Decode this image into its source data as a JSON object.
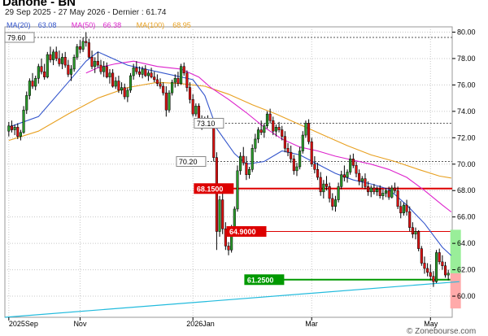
{
  "header": {
    "title": "Danone - BN",
    "subtitle": "29 Sep 2025 - 27 May 2026 - Dernier : 61.74"
  },
  "legend": [
    {
      "name": "MA(20)",
      "value": "63.08",
      "color": "#3355cc"
    },
    {
      "name": "MA(50)",
      "value": "66.38",
      "color": "#dd22cc"
    },
    {
      "name": "MA(100)",
      "value": "68.95",
      "color": "#e8a020"
    }
  ],
  "watermark": "© Zonebourse.com",
  "chart_data": {
    "type": "candlestick",
    "title": "Danone - BN",
    "y_axis": {
      "min": 58.4,
      "max": 80.4,
      "ticks": [
        "60.00",
        "62.00",
        "64.00",
        "66.00",
        "68.00",
        "70.00",
        "72.00",
        "74.00",
        "76.00",
        "78.00",
        "80.00"
      ],
      "position": "right"
    },
    "x_axis": {
      "labels": [
        "2025Sep",
        "Nov",
        "2026Jan",
        "Mar",
        "May"
      ],
      "label_index": [
        0,
        24,
        62,
        102,
        142
      ]
    },
    "ohlc": [
      [
        72.5,
        73.2,
        72.1,
        72.9
      ],
      [
        72.9,
        73.3,
        72.4,
        72.6
      ],
      [
        72.6,
        73.0,
        72.2,
        72.8
      ],
      [
        72.8,
        73.1,
        71.9,
        72.1
      ],
      [
        72.1,
        72.6,
        71.8,
        72.4
      ],
      [
        72.4,
        74.4,
        72.3,
        74.1
      ],
      [
        74.1,
        75.5,
        73.8,
        75.2
      ],
      [
        75.2,
        76.5,
        74.9,
        76.3
      ],
      [
        76.3,
        76.9,
        75.7,
        75.9
      ],
      [
        75.9,
        76.7,
        75.6,
        76.5
      ],
      [
        76.5,
        77.6,
        76.1,
        77.4
      ],
      [
        77.4,
        78.0,
        76.8,
        77.0
      ],
      [
        77.0,
        77.6,
        76.4,
        76.6
      ],
      [
        76.6,
        78.5,
        76.5,
        78.3
      ],
      [
        78.3,
        78.9,
        77.7,
        77.9
      ],
      [
        77.9,
        78.7,
        77.5,
        78.5
      ],
      [
        78.5,
        78.9,
        77.8,
        78.0
      ],
      [
        78.0,
        78.6,
        77.4,
        77.6
      ],
      [
        77.6,
        78.4,
        77.2,
        78.1
      ],
      [
        78.1,
        78.5,
        77.3,
        77.5
      ],
      [
        77.5,
        77.9,
        76.6,
        76.8
      ],
      [
        76.8,
        77.5,
        76.3,
        77.2
      ],
      [
        77.2,
        78.3,
        77.0,
        78.1
      ],
      [
        78.1,
        79.1,
        77.9,
        78.9
      ],
      [
        78.9,
        79.4,
        78.4,
        78.7
      ],
      [
        78.7,
        79.6,
        78.5,
        79.3
      ],
      [
        79.3,
        80.0,
        78.9,
        79.2
      ],
      [
        79.2,
        79.5,
        78.0,
        78.1
      ],
      [
        78.1,
        78.6,
        77.2,
        77.4
      ],
      [
        77.4,
        78.1,
        76.9,
        77.8
      ],
      [
        77.8,
        78.5,
        77.3,
        77.5
      ],
      [
        77.5,
        77.9,
        76.8,
        77.0
      ],
      [
        77.0,
        77.8,
        76.6,
        77.4
      ],
      [
        77.4,
        77.7,
        76.5,
        76.6
      ],
      [
        76.6,
        77.2,
        76.1,
        76.9
      ],
      [
        76.9,
        77.2,
        75.8,
        75.9
      ],
      [
        75.9,
        76.6,
        75.7,
        76.3
      ],
      [
        76.3,
        76.7,
        75.4,
        75.6
      ],
      [
        75.6,
        76.2,
        75.3,
        75.8
      ],
      [
        75.8,
        76.1,
        74.9,
        75.1
      ],
      [
        75.1,
        75.8,
        74.7,
        75.6
      ],
      [
        75.6,
        76.9,
        75.4,
        76.7
      ],
      [
        76.7,
        77.6,
        76.4,
        77.3
      ],
      [
        77.3,
        77.8,
        76.8,
        77.0
      ],
      [
        77.0,
        77.4,
        76.6,
        76.8
      ],
      [
        76.8,
        77.4,
        76.5,
        77.2
      ],
      [
        77.2,
        77.5,
        76.6,
        76.7
      ],
      [
        76.7,
        77.1,
        76.3,
        76.9
      ],
      [
        76.9,
        77.3,
        76.5,
        76.6
      ],
      [
        76.6,
        77.0,
        76.2,
        76.4
      ],
      [
        76.4,
        76.8,
        75.9,
        76.1
      ],
      [
        76.1,
        76.5,
        75.7,
        75.9
      ],
      [
        75.9,
        76.2,
        75.2,
        75.4
      ],
      [
        75.4,
        75.9,
        73.6,
        74.1
      ],
      [
        74.1,
        75.6,
        73.9,
        75.4
      ],
      [
        75.4,
        76.4,
        75.2,
        76.2
      ],
      [
        76.2,
        76.8,
        75.8,
        76.5
      ],
      [
        76.5,
        77.0,
        75.9,
        76.1
      ],
      [
        76.1,
        77.6,
        76.0,
        77.4
      ],
      [
        77.4,
        77.7,
        76.7,
        76.9
      ],
      [
        76.9,
        77.1,
        75.5,
        75.8
      ],
      [
        75.8,
        76.2,
        74.6,
        74.9
      ],
      [
        74.9,
        75.3,
        73.6,
        73.8
      ],
      [
        73.8,
        74.6,
        73.6,
        74.4
      ],
      [
        74.4,
        74.6,
        73.1,
        73.3
      ],
      [
        73.3,
        73.7,
        72.6,
        73.1
      ],
      [
        73.1,
        73.6,
        72.8,
        73.4
      ],
      [
        73.4,
        73.7,
        72.9,
        73.0
      ],
      [
        73.0,
        73.3,
        72.7,
        72.9
      ],
      [
        72.9,
        73.1,
        70.2,
        70.5
      ],
      [
        70.5,
        70.9,
        63.5,
        64.9
      ],
      [
        64.9,
        67.6,
        64.5,
        67.3
      ],
      [
        67.3,
        67.8,
        64.7,
        65.1
      ],
      [
        65.1,
        65.6,
        63.5,
        63.8
      ],
      [
        63.8,
        64.1,
        63.1,
        63.5
      ],
      [
        63.5,
        65.4,
        63.3,
        65.1
      ],
      [
        65.1,
        66.8,
        64.9,
        66.6
      ],
      [
        66.6,
        69.9,
        66.4,
        69.5
      ],
      [
        69.5,
        70.9,
        69.2,
        70.6
      ],
      [
        70.6,
        71.3,
        69.9,
        70.1
      ],
      [
        70.1,
        70.6,
        68.8,
        69.2
      ],
      [
        69.2,
        69.8,
        68.9,
        69.6
      ],
      [
        69.6,
        71.5,
        69.4,
        71.2
      ],
      [
        71.2,
        72.3,
        70.9,
        71.9
      ],
      [
        71.9,
        72.8,
        71.6,
        72.6
      ],
      [
        72.6,
        73.3,
        72.2,
        72.4
      ],
      [
        72.4,
        73.1,
        72.0,
        72.9
      ],
      [
        72.9,
        74.0,
        72.7,
        73.8
      ],
      [
        73.8,
        74.2,
        73.1,
        73.3
      ],
      [
        73.3,
        73.6,
        72.2,
        72.5
      ],
      [
        72.5,
        73.0,
        72.1,
        72.8
      ],
      [
        72.8,
        73.2,
        72.4,
        72.6
      ],
      [
        72.6,
        72.9,
        71.8,
        72.1
      ],
      [
        72.1,
        72.5,
        70.9,
        71.2
      ],
      [
        71.2,
        71.6,
        70.6,
        70.9
      ],
      [
        70.9,
        71.4,
        70.1,
        70.4
      ],
      [
        70.4,
        70.7,
        69.2,
        69.5
      ],
      [
        69.5,
        70.1,
        69.1,
        69.8
      ],
      [
        69.8,
        71.3,
        69.6,
        71.0
      ],
      [
        71.0,
        72.5,
        70.8,
        72.2
      ],
      [
        72.2,
        73.3,
        72.0,
        73.1
      ],
      [
        73.1,
        73.4,
        71.5,
        71.7
      ],
      [
        71.7,
        72.0,
        69.8,
        70.0
      ],
      [
        70.0,
        70.6,
        69.3,
        69.6
      ],
      [
        69.6,
        70.1,
        68.8,
        69.0
      ],
      [
        69.0,
        69.4,
        67.6,
        67.9
      ],
      [
        67.9,
        68.8,
        67.4,
        68.5
      ],
      [
        68.5,
        69.1,
        68.0,
        68.3
      ],
      [
        68.3,
        68.6,
        67.1,
        67.4
      ],
      [
        67.4,
        67.8,
        66.5,
        66.8
      ],
      [
        66.8,
        67.6,
        66.4,
        67.3
      ],
      [
        67.3,
        68.6,
        67.1,
        68.3
      ],
      [
        68.3,
        69.5,
        68.1,
        69.2
      ],
      [
        69.2,
        69.9,
        68.7,
        69.0
      ],
      [
        69.0,
        69.6,
        68.6,
        69.4
      ],
      [
        69.4,
        70.7,
        69.2,
        70.4
      ],
      [
        70.4,
        70.8,
        69.7,
        69.9
      ],
      [
        69.9,
        70.2,
        69.0,
        69.3
      ],
      [
        69.3,
        69.6,
        68.4,
        68.7
      ],
      [
        68.7,
        69.1,
        68.2,
        68.9
      ],
      [
        68.9,
        69.3,
        68.1,
        68.3
      ],
      [
        68.3,
        68.7,
        67.6,
        67.9
      ],
      [
        67.9,
        68.4,
        67.5,
        68.2
      ],
      [
        68.2,
        68.5,
        67.7,
        67.9
      ],
      [
        67.9,
        68.3,
        67.6,
        68.1
      ],
      [
        68.1,
        68.4,
        67.4,
        67.6
      ],
      [
        67.6,
        68.1,
        67.3,
        67.8
      ],
      [
        67.8,
        68.2,
        67.5,
        68.0
      ],
      [
        68.0,
        68.3,
        67.3,
        67.5
      ],
      [
        67.5,
        68.4,
        67.4,
        68.2
      ],
      [
        68.2,
        68.6,
        67.8,
        68.0
      ],
      [
        68.0,
        68.3,
        66.6,
        66.8
      ],
      [
        66.8,
        67.2,
        65.9,
        66.3
      ],
      [
        66.3,
        67.1,
        66.1,
        66.9
      ],
      [
        66.9,
        67.3,
        66.1,
        66.4
      ],
      [
        66.4,
        66.8,
        64.9,
        65.2
      ],
      [
        65.2,
        65.6,
        64.4,
        64.7
      ],
      [
        64.7,
        65.2,
        64.3,
        64.9
      ],
      [
        64.9,
        65.0,
        63.4,
        63.6
      ],
      [
        63.6,
        63.8,
        62.3,
        62.5
      ],
      [
        62.5,
        63.0,
        61.7,
        62.1
      ],
      [
        62.1,
        62.5,
        61.5,
        61.8
      ],
      [
        61.8,
        62.4,
        61.2,
        61.5
      ],
      [
        61.5,
        61.9,
        60.7,
        61.1
      ],
      [
        61.1,
        63.5,
        61.0,
        63.3
      ],
      [
        63.3,
        63.6,
        62.4,
        62.6
      ],
      [
        62.6,
        63.1,
        62.0,
        62.3
      ],
      [
        62.3,
        62.6,
        61.4,
        61.6
      ],
      [
        61.6,
        62.0,
        61.2,
        61.74
      ]
    ],
    "ma20": [
      [
        0,
        72.8
      ],
      [
        10,
        73.6
      ],
      [
        20,
        76.2
      ],
      [
        26,
        77.8
      ],
      [
        30,
        78.5
      ],
      [
        40,
        77.5
      ],
      [
        50,
        77.0
      ],
      [
        62,
        76.4
      ],
      [
        66,
        75.2
      ],
      [
        70,
        72.7
      ],
      [
        76,
        70.8
      ],
      [
        80,
        70.0
      ],
      [
        86,
        70.2
      ],
      [
        92,
        71.0
      ],
      [
        98,
        70.7
      ],
      [
        104,
        70.0
      ],
      [
        110,
        69.3
      ],
      [
        116,
        68.8
      ],
      [
        122,
        68.5
      ],
      [
        128,
        68.1
      ],
      [
        134,
        66.9
      ],
      [
        140,
        65.5
      ],
      [
        146,
        63.7
      ],
      [
        149,
        63.08
      ]
    ],
    "ma50": [
      [
        26,
        76.9
      ],
      [
        30,
        77.3
      ],
      [
        36,
        77.6
      ],
      [
        42,
        77.8
      ],
      [
        50,
        77.4
      ],
      [
        58,
        77.2
      ],
      [
        64,
        76.6
      ],
      [
        68,
        75.8
      ],
      [
        74,
        74.9
      ],
      [
        80,
        73.9
      ],
      [
        86,
        72.8
      ],
      [
        92,
        71.9
      ],
      [
        98,
        71.3
      ],
      [
        104,
        71.0
      ],
      [
        110,
        70.6
      ],
      [
        116,
        70.3
      ],
      [
        122,
        70.0
      ],
      [
        128,
        69.6
      ],
      [
        134,
        69.0
      ],
      [
        140,
        68.0
      ],
      [
        146,
        66.9
      ],
      [
        149,
        66.38
      ]
    ],
    "ma100": [
      [
        0,
        71.8
      ],
      [
        10,
        72.5
      ],
      [
        20,
        73.8
      ],
      [
        30,
        75.0
      ],
      [
        40,
        75.8
      ],
      [
        50,
        76.2
      ],
      [
        58,
        76.1
      ],
      [
        66,
        75.9
      ],
      [
        74,
        75.3
      ],
      [
        82,
        74.5
      ],
      [
        90,
        73.8
      ],
      [
        98,
        73.0
      ],
      [
        106,
        72.2
      ],
      [
        114,
        71.4
      ],
      [
        122,
        70.7
      ],
      [
        130,
        70.2
      ],
      [
        138,
        69.6
      ],
      [
        145,
        69.1
      ],
      [
        149,
        68.95
      ]
    ],
    "trendline": {
      "from": [
        0,
        57.6
      ],
      "to": [
        149,
        61.1
      ],
      "color": "#22bbdd"
    },
    "horizontal_lines": [
      {
        "label": "79.60",
        "value": 79.6,
        "style": "dashed",
        "color": "#555555",
        "from": 0
      },
      {
        "label": "73.10",
        "value": 73.1,
        "style": "dashed",
        "color": "#555555",
        "from": 63
      },
      {
        "label": "70.20",
        "value": 70.2,
        "style": "dashed",
        "color": "#555555",
        "from": 57
      },
      {
        "label": "68.1500",
        "value": 68.15,
        "style": "solid",
        "color": "#dd0000",
        "from": 63,
        "thick": true
      },
      {
        "label": "64.9000",
        "value": 64.9,
        "style": "solid",
        "color": "#dd0000",
        "from": 74
      },
      {
        "label": "61.2500",
        "value": 61.25,
        "style": "solid",
        "color": "#009900",
        "from": 80,
        "thick": true
      }
    ],
    "target_zones": [
      {
        "from": 65.0,
        "to": 61.7,
        "color": "#99ee99"
      },
      {
        "from": 61.7,
        "to": 59.1,
        "color": "#ffaaaa"
      }
    ]
  }
}
